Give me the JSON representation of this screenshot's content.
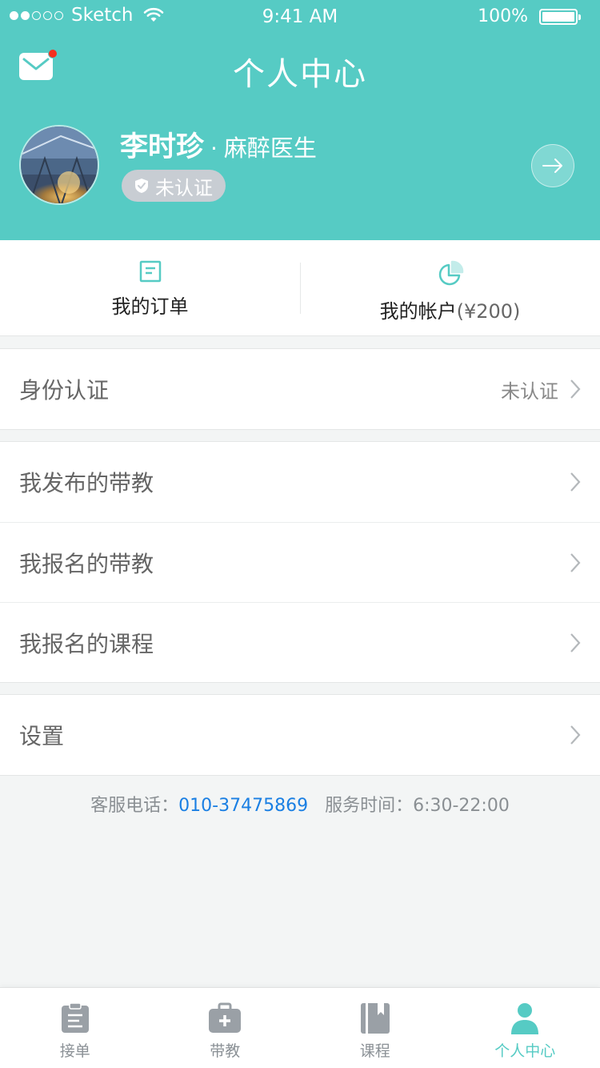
{
  "status_bar": {
    "carrier": "Sketch",
    "time": "9:41 AM",
    "battery": "100%"
  },
  "header": {
    "title": "个人中心",
    "has_unread_mail": true
  },
  "profile": {
    "name": "李时珍",
    "separator": "·",
    "role": "麻醉医生",
    "verify_status": "未认证"
  },
  "quick_links": [
    {
      "label": "我的订单",
      "icon": "order-icon"
    },
    {
      "label": "我的帐户",
      "amount": "(¥200)",
      "icon": "pie-chart-icon"
    }
  ],
  "menu": {
    "identity": {
      "label": "身份认证",
      "value": "未认证"
    },
    "teaching_items": [
      {
        "label": "我发布的带教"
      },
      {
        "label": "我报名的带教"
      },
      {
        "label": "我报名的课程"
      }
    ],
    "settings": {
      "label": "设置"
    }
  },
  "service": {
    "phone_label": "客服电话：",
    "phone": "010-37475869",
    "hours_label": "服务时间：",
    "hours": "6:30-22:00"
  },
  "tabbar": [
    {
      "label": "接单",
      "icon": "clipboard-icon",
      "active": false
    },
    {
      "label": "带教",
      "icon": "medkit-icon",
      "active": false
    },
    {
      "label": "课程",
      "icon": "book-icon",
      "active": false
    },
    {
      "label": "个人中心",
      "icon": "user-icon",
      "active": true
    }
  ],
  "colors": {
    "primary": "#56cbc4",
    "badge_grey": "#c8cdd3",
    "link_blue": "#1a7fe3",
    "notification_red": "#f5301e"
  }
}
